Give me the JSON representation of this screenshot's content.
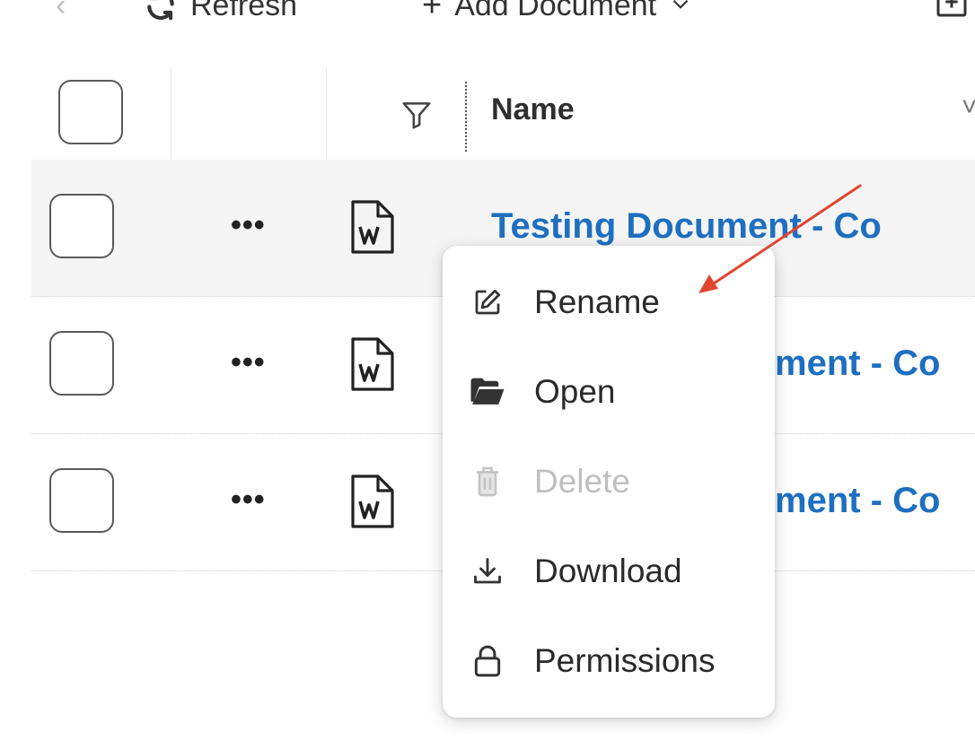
{
  "toolbar": {
    "back_icon": "chevron-left-icon",
    "refresh_label": "Refresh",
    "add_document_label": "Add Document"
  },
  "grid": {
    "header": {
      "name_label": "Name"
    },
    "rows": [
      {
        "name": "Testing Document - Co",
        "more": "•••"
      },
      {
        "name": "ment - Co",
        "more": "•••"
      },
      {
        "name": "ment - Co",
        "more": "•••"
      }
    ]
  },
  "context_menu": {
    "items": [
      {
        "label": "Rename",
        "icon": "edit-icon",
        "enabled": true
      },
      {
        "label": "Open",
        "icon": "folder-open-icon",
        "enabled": true
      },
      {
        "label": "Delete",
        "icon": "trash-icon",
        "enabled": false
      },
      {
        "label": "Download",
        "icon": "download-icon",
        "enabled": true
      },
      {
        "label": "Permissions",
        "icon": "lock-icon",
        "enabled": true
      }
    ]
  },
  "colors": {
    "link": "#1e6fc0",
    "disabled": "#bfbfbf",
    "annotation_arrow": "#e0452f"
  }
}
